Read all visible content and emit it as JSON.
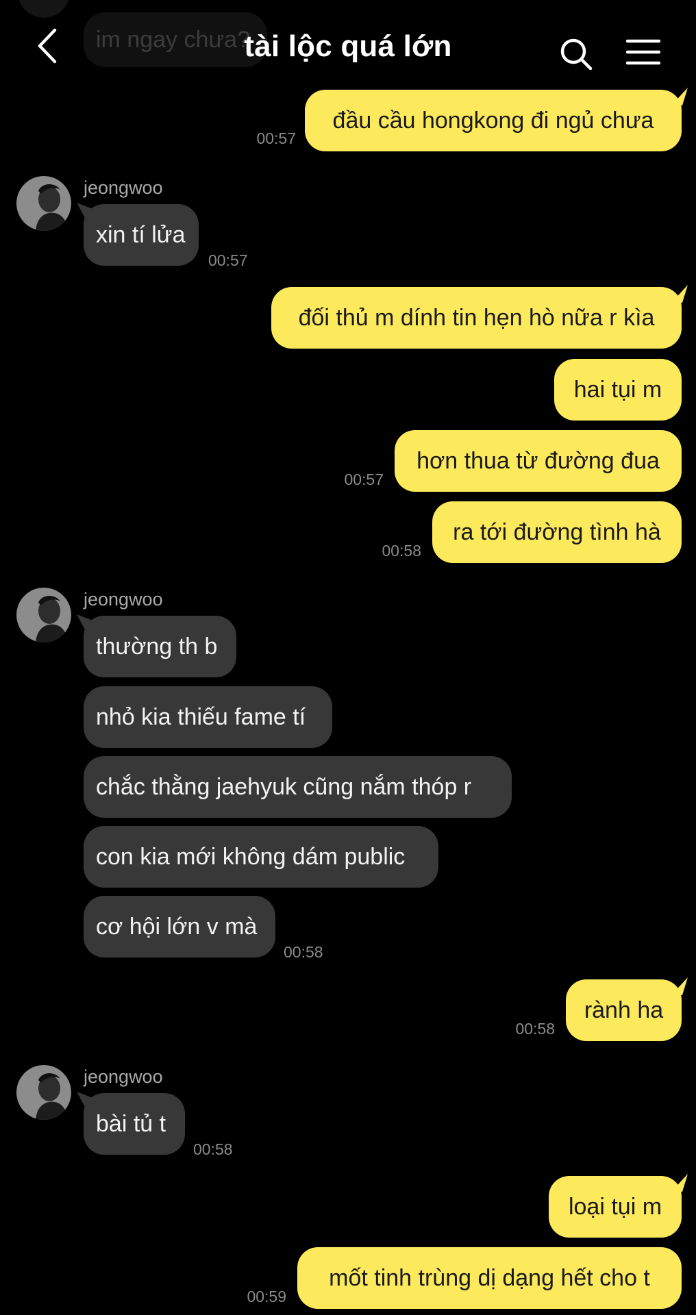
{
  "header": {
    "title": "tài lộc quá lớn",
    "faded_message": "im ngay chưa?"
  },
  "colors": {
    "background": "#000000",
    "outgoing_bubble": "#fde95c",
    "incoming_bubble": "#383838",
    "timestamp": "#8a8a8a"
  },
  "icons": [
    "chevron-left-icon",
    "search-icon",
    "hamburger-menu-icon"
  ],
  "messages": {
    "m1": {
      "text": "đầu cầu hongkong đi ngủ chưa",
      "time": "00:57"
    },
    "name1": "jeongwoo",
    "m2": {
      "text": "xin tí lửa",
      "time": "00:57"
    },
    "m3": {
      "text": "đối thủ m dính tin hẹn hò nữa r kìa"
    },
    "m4": {
      "text": "hai tụi m"
    },
    "m5": {
      "text": "hơn thua từ đường đua",
      "time": "00:57"
    },
    "m6": {
      "text": "ra tới đường tình hà",
      "time": "00:58"
    },
    "name2": "jeongwoo",
    "m7": {
      "text": "thường th b"
    },
    "m8": {
      "text": "nhỏ kia thiếu fame tí"
    },
    "m9": {
      "text": "chắc thằng jaehyuk cũng nắm thóp r"
    },
    "m10": {
      "text": "con kia mới không dám public"
    },
    "m11": {
      "text": "cơ hội lớn v mà",
      "time": "00:58"
    },
    "m12": {
      "text": "rành ha",
      "time": "00:58"
    },
    "name3": "jeongwoo",
    "m13": {
      "text": "bài tủ t",
      "time": "00:58"
    },
    "m14": {
      "text": "loại tụi m"
    },
    "m15": {
      "text": "mốt tinh trùng dị dạng hết cho t",
      "time": "00:59"
    }
  }
}
